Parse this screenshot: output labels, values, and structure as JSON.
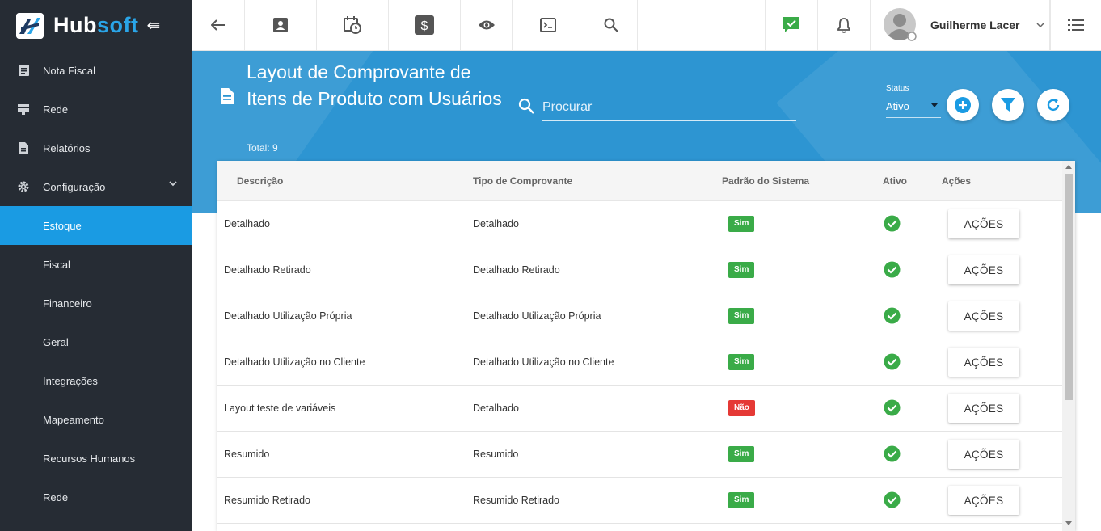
{
  "brand": {
    "name_a": "Hub",
    "name_b": "soft",
    "collapse_icon": "collapse-arrow-icon"
  },
  "sidebar": {
    "items": [
      {
        "label": "Nota Fiscal",
        "icon": "document-icon"
      },
      {
        "label": "Rede",
        "icon": "server-icon"
      },
      {
        "label": "Relatórios",
        "icon": "report-icon"
      },
      {
        "label": "Configuração",
        "icon": "gear-icon"
      },
      {
        "label": "Estoque"
      },
      {
        "label": "Fiscal"
      },
      {
        "label": "Financeiro"
      },
      {
        "label": "Geral"
      },
      {
        "label": "Integrações"
      },
      {
        "label": "Mapeamento"
      },
      {
        "label": "Recursos Humanos"
      },
      {
        "label": "Rede"
      }
    ],
    "active_color": "#1a9be3"
  },
  "topbar": {
    "icons": [
      "back-arrow-icon",
      "contact-icon",
      "calendar-clock-icon",
      "dollar-icon",
      "eye-icon",
      "terminal-icon",
      "search-icon",
      "chat-check-icon",
      "bell-icon",
      "list-menu-icon"
    ],
    "user_name": "Guilherme Lacer"
  },
  "header": {
    "title": "Layout de Comprovante de Itens de Produto com Usuários",
    "total": "Total: 9",
    "search_placeholder": "Procurar",
    "status_label": "Status",
    "status_value": "Ativo",
    "banner_color": "#2d95d2"
  },
  "table": {
    "columns": [
      "Descrição",
      "Tipo de Comprovante",
      "Padrão do Sistema",
      "Ativo",
      "Ações"
    ],
    "rows": [
      {
        "descricao": "Detalhado",
        "tipo": "Detalhado",
        "padrao": "Sim",
        "ativo": true,
        "acoes": "AÇÕES"
      },
      {
        "descricao": "Detalhado Retirado",
        "tipo": "Detalhado Retirado",
        "padrao": "Sim",
        "ativo": true,
        "acoes": "AÇÕES"
      },
      {
        "descricao": "Detalhado Utilização Própria",
        "tipo": "Detalhado Utilização Própria",
        "padrao": "Sim",
        "ativo": true,
        "acoes": "AÇÕES"
      },
      {
        "descricao": "Detalhado Utilização no Cliente",
        "tipo": "Detalhado Utilização no Cliente",
        "padrao": "Sim",
        "ativo": true,
        "acoes": "AÇÕES"
      },
      {
        "descricao": "Layout teste de variáveis",
        "tipo": "Detalhado",
        "padrao": "Não",
        "ativo": true,
        "acoes": "AÇÕES"
      },
      {
        "descricao": "Resumido",
        "tipo": "Resumido",
        "padrao": "Sim",
        "ativo": true,
        "acoes": "AÇÕES"
      },
      {
        "descricao": "Resumido Retirado",
        "tipo": "Resumido Retirado",
        "padrao": "Sim",
        "ativo": true,
        "acoes": "AÇÕES"
      }
    ],
    "colors": {
      "yes": "#3aab48",
      "no": "#e53935",
      "check": "#3aab48"
    }
  }
}
